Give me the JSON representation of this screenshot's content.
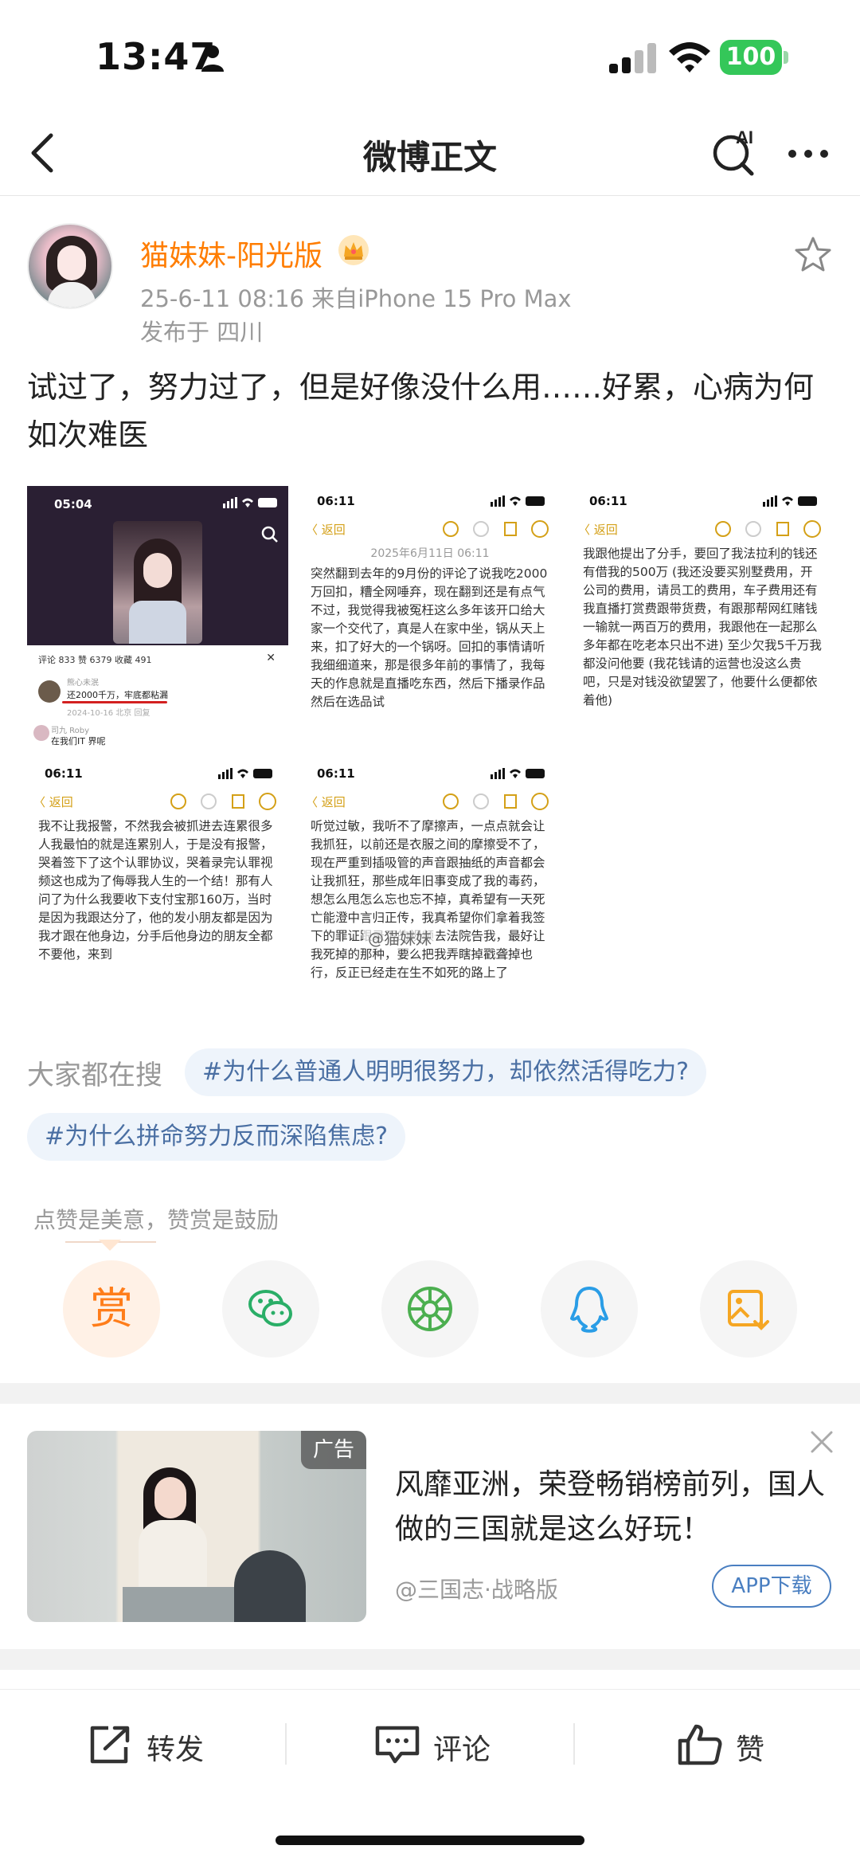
{
  "status_bar": {
    "time": "13:47",
    "battery": "100"
  },
  "nav": {
    "title": "微博正文"
  },
  "post": {
    "user_name": "猫妹妹-阳光版",
    "meta": "25-6-11 08:16  来自iPhone 15 Pro Max",
    "location": "发布于 四川",
    "text": "试过了，努力过了，但是好像没什么用……好累，心病为何如次难医"
  },
  "images": {
    "img1": {
      "time": "05:04",
      "stats": "评论 833      赞 6379      收藏 491",
      "close": "✕",
      "comment_user": "熊心未泯",
      "comment_text": "还2000千万，牢底都粘漏",
      "comment_date": "2024-10-16  北京      回复",
      "reply_user": "司九 Roby",
      "reply_text": "在我们IT 界呢"
    },
    "img2": {
      "time": "06:11",
      "back": "〈 返回",
      "date": "2025年6月11日 06:11",
      "body": "突然翻到去年的9月份的评论了说我吃2000万回扣，糟全网唾弃，现在翻到还是有点气不过，我觉得我被冤枉这么多年该开口给大家一个交代了，真是人在家中坐，锅从天上来，扣了好大的一个锅呀。回扣的事情请听我细细道来，那是很多年前的事情了，我每天的作息就是直播吃东西，然后下播录作品然后在选品试"
    },
    "img3": {
      "time": "06:11",
      "back": "〈 返回",
      "body": "我跟他提出了分手，要回了我法拉利的钱还有借我的500万 (我还没要买别墅费用，开公司的费用，请员工的费用，车子费用还有我直播打赏费跟带货费，有跟那帮网红赌钱一输就一两百万的费用，我跟他在一起那么多年都在吃老本只出不进) 至少欠我5千万我都没问他要 (我花钱请的运营也没这么贵吧，只是对钱没欲望罢了，他要什么便都依着他)"
    },
    "img4": {
      "time": "06:11",
      "back": "〈 返回",
      "body": "我不让我报警，不然我会被抓进去连累很多人我最怕的就是连累别人，于是没有报警，哭着签下了这个认罪协议，哭着录完认罪视频这也成为了侮辱我人生的一个结！那有人问了为什么我要收下支付宝那160万，当时是因为我跟达分了，他的发小朋友都是因为我才跟在他身边，分手后他身边的朋友全都不要他，来到"
    },
    "img5": {
      "time": "06:11",
      "back": "〈 返回",
      "body": "听觉过敏，我听不了摩擦声，一点点就会让我抓狂，以前还是衣服之间的摩擦受不了，现在严重到插吸管的声音跟抽纸的声音都会让我抓狂，那些成年旧事变成了我的毒药，想怎么甩怎么忘也忘不掉，真希望有一天死亡能澄中言归正传，我真希望你们拿着我签下的罪证跟录下的视频去法院告我，最好让我死掉的那种，要么把我弄瞎掉戳聋掉也行，反正已经走在生不如死的路上了"
    },
    "watermark": "@猫妹妹"
  },
  "search": {
    "label": "大家都在搜",
    "topics": [
      "#为什么普通人明明很努力，却依然活得吃力?",
      "#为什么拼命努力反而深陷焦虑?"
    ]
  },
  "reward": {
    "tip": "点赞是美意，赞赏是鼓励",
    "reward_char": "赏"
  },
  "ad": {
    "badge": "广告",
    "title": "风靡亚洲，荣登畅销榜前列，国人做的三国就是这么好玩！",
    "source": "@三国志·战略版",
    "download": "APP下载"
  },
  "bottom_bar": {
    "repost": "转发",
    "comment": "评论",
    "like": "赞"
  },
  "colors": {
    "orange": "#ff7d00",
    "topic_blue": "#4a6fa3",
    "gray_text": "#999999"
  }
}
